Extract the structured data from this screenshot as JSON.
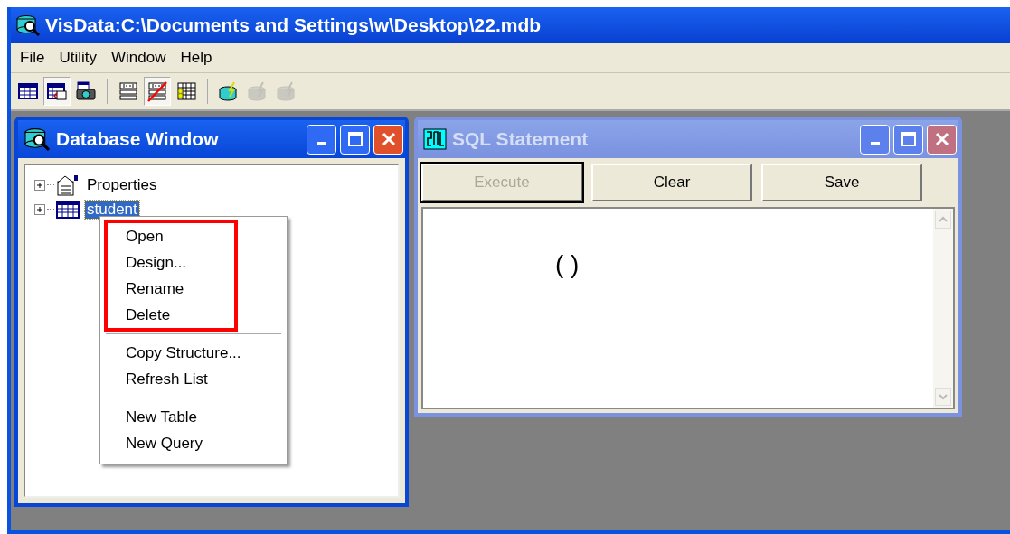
{
  "window": {
    "title": "VisData:C:\\Documents and Settings\\w\\Desktop\\22.mdb"
  },
  "menu_bar": [
    "File",
    "Utility",
    "Window",
    "Help"
  ],
  "toolbar": [
    [
      {
        "kind": "table",
        "pressed": false,
        "disabled": false
      },
      {
        "kind": "form",
        "pressed": true,
        "disabled": false
      },
      {
        "kind": "camera",
        "pressed": false,
        "disabled": false
      }
    ],
    [
      {
        "kind": "nav",
        "pressed": false,
        "disabled": false
      },
      {
        "kind": "nav-off",
        "pressed": true,
        "disabled": false
      },
      {
        "kind": "grid",
        "pressed": false,
        "disabled": false
      }
    ],
    [
      {
        "kind": "bolt",
        "pressed": false,
        "disabled": false
      },
      {
        "kind": "bolt",
        "pressed": false,
        "disabled": true
      },
      {
        "kind": "bolt",
        "pressed": false,
        "disabled": true
      }
    ]
  ],
  "database_window": {
    "title": "Database Window",
    "active": true,
    "tree": [
      {
        "label": "Properties",
        "kind": "properties",
        "selected": false
      },
      {
        "label": "student",
        "kind": "table",
        "selected": true
      }
    ],
    "context_menu": [
      {
        "highlighted": true,
        "items": [
          "Open",
          "Design...",
          "Rename",
          "Delete"
        ]
      },
      {
        "highlighted": false,
        "items": [
          "Copy Structure...",
          "Refresh List"
        ]
      },
      {
        "highlighted": false,
        "items": [
          "New Table",
          "New Query"
        ]
      }
    ]
  },
  "sql_window": {
    "title": "SQL Statement",
    "active": false,
    "buttons": [
      {
        "label": "Execute",
        "disabled": true,
        "default": true
      },
      {
        "label": "Clear",
        "disabled": false,
        "default": false
      },
      {
        "label": "Save",
        "disabled": false,
        "default": false
      }
    ],
    "text": "( )"
  }
}
